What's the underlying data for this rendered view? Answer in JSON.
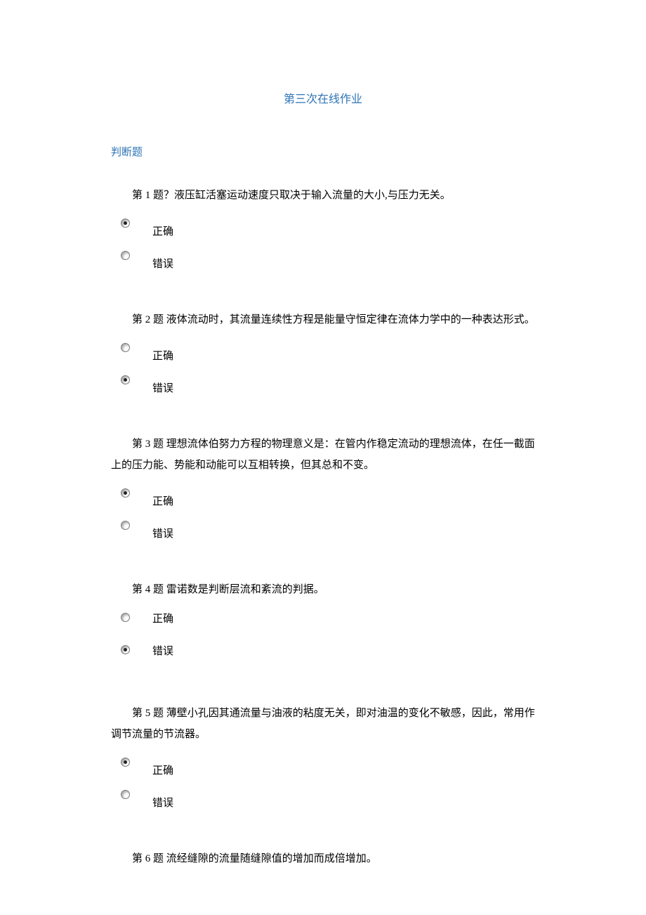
{
  "title": "第三次在线作业",
  "section": "判断题",
  "opt_true": "正确",
  "opt_false": "错误",
  "questions": [
    {
      "text": "第 1 题？液压缸活塞运动速度只取决于输入流量的大小,与压力无关。",
      "selected": "true"
    },
    {
      "text": "第 2 题  液体流动时，其流量连续性方程是能量守恒定律在流体力学中的一种表达形式。",
      "selected": "false"
    },
    {
      "text": "第 3 题  理想流体伯努力方程的物理意义是：在管内作稳定流动的理想流体，在任一截面上的压力能、势能和动能可以互相转换，但其总和不变。",
      "selected": "true"
    },
    {
      "text": "第 4 题  雷诺数是判断层流和紊流的判据。",
      "selected": "false"
    },
    {
      "text": "第 5 题  薄壁小孔因其通流量与油液的粘度无关，即对油温的变化不敏感，因此，常用作调节流量的节流器。",
      "selected": "true"
    },
    {
      "text": "第 6 题  流经缝隙的流量随缝隙值的增加而成倍增加。",
      "selected": ""
    }
  ]
}
